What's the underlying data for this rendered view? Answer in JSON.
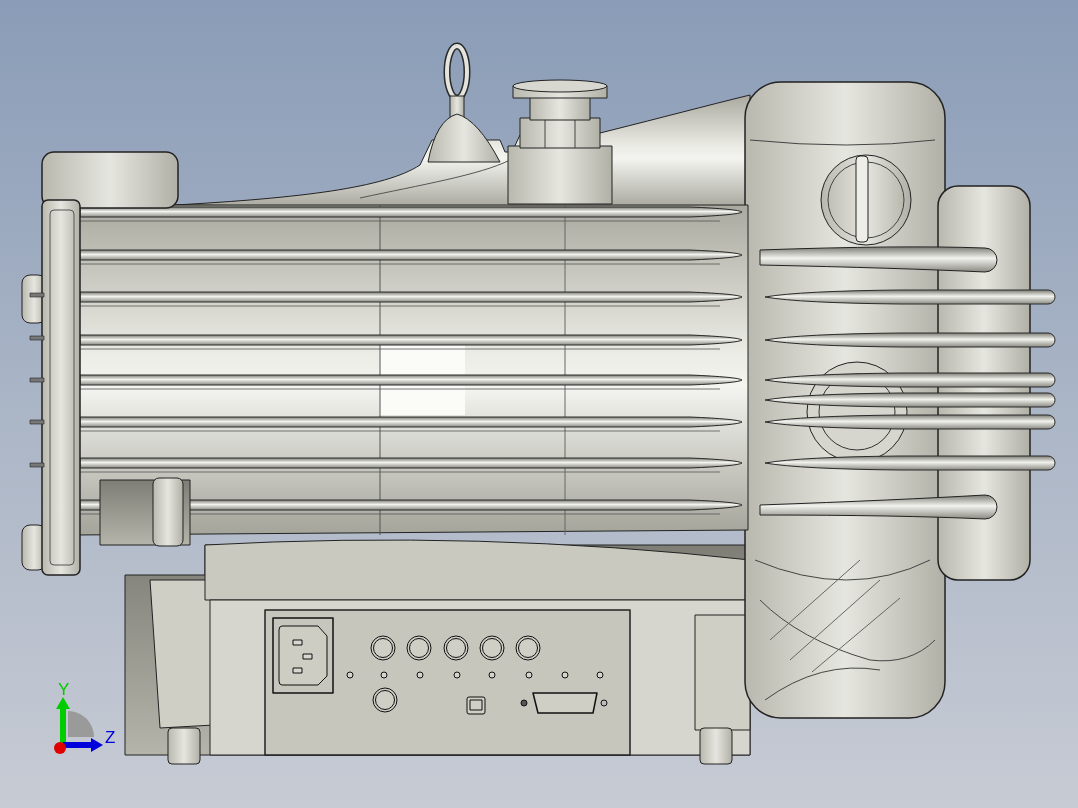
{
  "viewport": {
    "triad": {
      "axes": [
        {
          "label": "Y",
          "kind": "vertical",
          "color": "#00cc00"
        },
        {
          "label": "Z",
          "kind": "horizontal",
          "color": "#0000dd"
        }
      ]
    }
  }
}
